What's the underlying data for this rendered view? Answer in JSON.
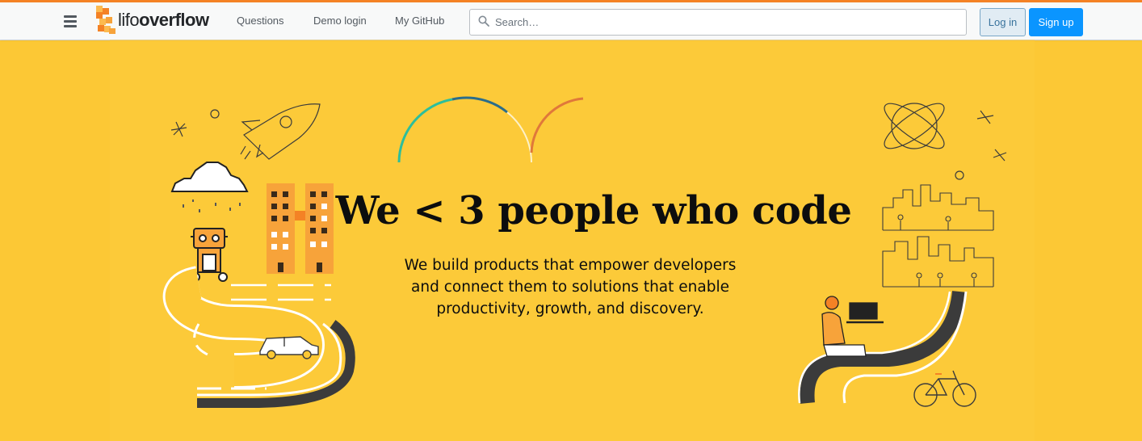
{
  "header": {
    "logo_light": "lifo",
    "logo_bold": "overflow",
    "nav": [
      "Questions",
      "Demo login",
      "My GitHub"
    ],
    "search_placeholder": "Search…",
    "login_label": "Log in",
    "signup_label": "Sign up"
  },
  "hero": {
    "title": "We < 3 people who code",
    "subtitle": "We build products that empower developers and connect them to solutions that enable productivity, growth, and discovery."
  },
  "colors": {
    "accent": "#f48225",
    "hero_bg": "#fcc835",
    "primary_button": "#0a95ff"
  },
  "icons": [
    "hamburger-icon",
    "lifo-logo-icon",
    "search-icon"
  ]
}
